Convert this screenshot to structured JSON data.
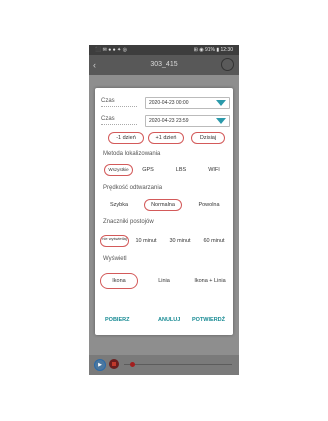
{
  "statusbar": {
    "left": "⬛ ✉ ● ● ✦ ◎",
    "right": "⊞ ◉ 91% ▮ 12:30"
  },
  "appbar": {
    "title": "303_415"
  },
  "dialog": {
    "from": {
      "label": "Czas",
      "value": "2020-04-23 00:00"
    },
    "to": {
      "label": "Czas",
      "value": "2020-04-23 23:59"
    },
    "day_buttons": [
      "-1 dzień",
      "+1 dzień",
      "Dzisiaj"
    ],
    "localization": {
      "title": "Metoda lokalizowania",
      "options": [
        "Wszystkie",
        "GPS",
        "LBS",
        "WIFI"
      ],
      "selected": "Wszystkie"
    },
    "speed": {
      "title": "Prędkość odtwarzania",
      "options": [
        "Szybka",
        "Normalna",
        "Powolna"
      ],
      "selected": "Normalna"
    },
    "stops": {
      "title": "Znaczniki postojów",
      "options": [
        "nie wyświetlaj",
        "10 minut",
        "30 minut",
        "60 minut"
      ],
      "selected": "nie wyświetlaj"
    },
    "display": {
      "title": "Wyświetl",
      "options": [
        "Ikona",
        "Linia",
        "Ikona + Linia"
      ],
      "selected": "Ikona"
    },
    "actions": {
      "download": "POBIERZ",
      "cancel": "ANULUJ",
      "confirm": "POTWIERDŹ"
    }
  }
}
